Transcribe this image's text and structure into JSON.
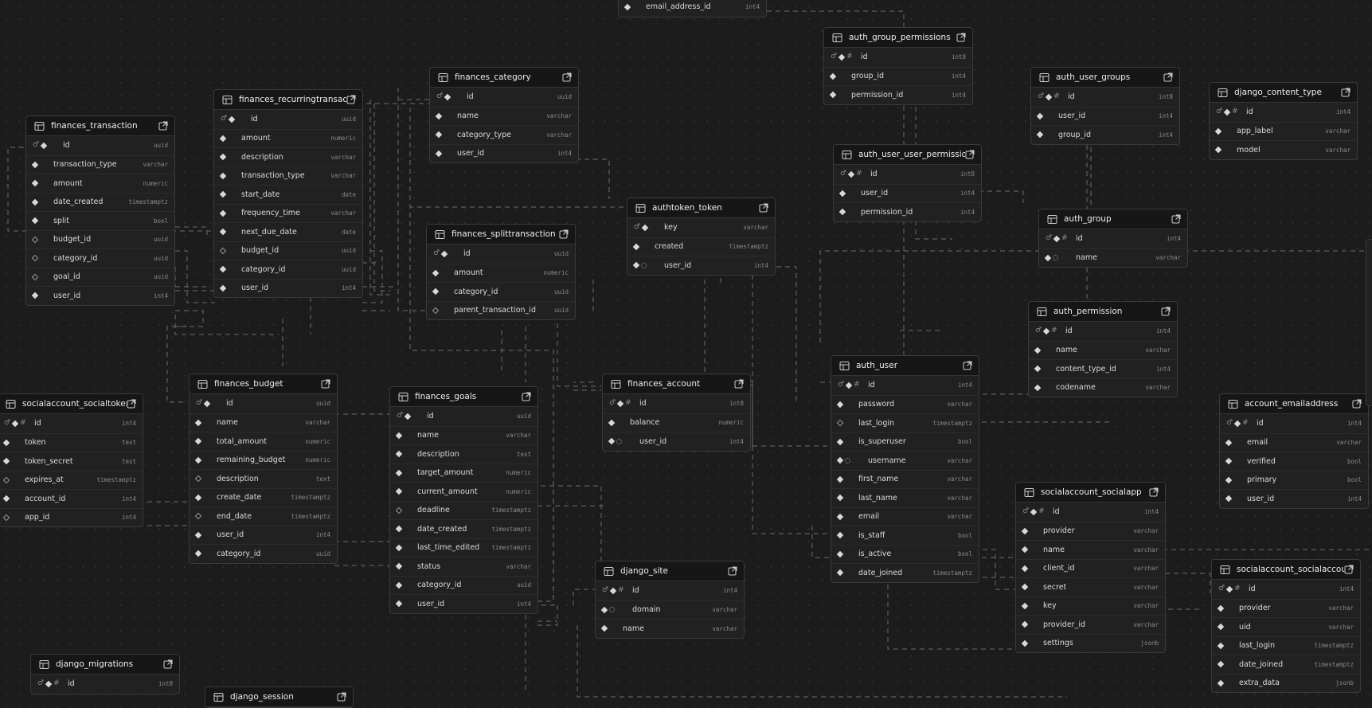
{
  "theme": {
    "background": "#1c1c1c",
    "table_bg": "#212121",
    "header_bg": "#161616",
    "edge": "#5e5e5e"
  },
  "tables": {
    "partial_top": {
      "columns": [
        {
          "name": "email_address_id",
          "type": "int4"
        }
      ]
    },
    "finances_transaction": {
      "name": "finances_transaction",
      "columns": [
        {
          "name": "id",
          "type": "uuid"
        },
        {
          "name": "transaction_type",
          "type": "varchar"
        },
        {
          "name": "amount",
          "type": "numeric"
        },
        {
          "name": "date_created",
          "type": "timestamptz"
        },
        {
          "name": "split",
          "type": "bool"
        },
        {
          "name": "budget_id",
          "type": "uuid"
        },
        {
          "name": "category_id",
          "type": "uuid"
        },
        {
          "name": "goal_id",
          "type": "uuid"
        },
        {
          "name": "user_id",
          "type": "int4"
        }
      ]
    },
    "finances_recurringtransaction": {
      "name": "finances_recurringtransaction",
      "columns": [
        {
          "name": "id",
          "type": "uuid"
        },
        {
          "name": "amount",
          "type": "numeric"
        },
        {
          "name": "description",
          "type": "varchar"
        },
        {
          "name": "transaction_type",
          "type": "varchar"
        },
        {
          "name": "start_date",
          "type": "date"
        },
        {
          "name": "frequency_time",
          "type": "varchar"
        },
        {
          "name": "next_due_date",
          "type": "date"
        },
        {
          "name": "budget_id",
          "type": "uuid"
        },
        {
          "name": "category_id",
          "type": "uuid"
        },
        {
          "name": "user_id",
          "type": "int4"
        }
      ]
    },
    "finances_category": {
      "name": "finances_category",
      "columns": [
        {
          "name": "id",
          "type": "uuid"
        },
        {
          "name": "name",
          "type": "varchar"
        },
        {
          "name": "category_type",
          "type": "varchar"
        },
        {
          "name": "user_id",
          "type": "int4"
        }
      ]
    },
    "finances_splittransaction": {
      "name": "finances_splittransaction",
      "columns": [
        {
          "name": "id",
          "type": "uuid"
        },
        {
          "name": "amount",
          "type": "numeric"
        },
        {
          "name": "category_id",
          "type": "uuid"
        },
        {
          "name": "parent_transaction_id",
          "type": "uuid"
        }
      ]
    },
    "authtoken_token": {
      "name": "authtoken_token",
      "columns": [
        {
          "name": "key",
          "type": "varchar"
        },
        {
          "name": "created",
          "type": "timestamptz"
        },
        {
          "name": "user_id",
          "type": "int4"
        }
      ]
    },
    "auth_group_permissions": {
      "name": "auth_group_permissions",
      "columns": [
        {
          "name": "id",
          "type": "int8"
        },
        {
          "name": "group_id",
          "type": "int4"
        },
        {
          "name": "permission_id",
          "type": "int4"
        }
      ]
    },
    "auth_user_user_permissions": {
      "name": "auth_user_user_permissions",
      "columns": [
        {
          "name": "id",
          "type": "int8"
        },
        {
          "name": "user_id",
          "type": "int4"
        },
        {
          "name": "permission_id",
          "type": "int4"
        }
      ]
    },
    "auth_user_groups": {
      "name": "auth_user_groups",
      "columns": [
        {
          "name": "id",
          "type": "int8"
        },
        {
          "name": "user_id",
          "type": "int4"
        },
        {
          "name": "group_id",
          "type": "int4"
        }
      ]
    },
    "django_content_type": {
      "name": "django_content_type",
      "columns": [
        {
          "name": "id",
          "type": "int4"
        },
        {
          "name": "app_label",
          "type": "varchar"
        },
        {
          "name": "model",
          "type": "varchar"
        }
      ]
    },
    "auth_group": {
      "name": "auth_group",
      "columns": [
        {
          "name": "id",
          "type": "int4"
        },
        {
          "name": "name",
          "type": "varchar"
        }
      ]
    },
    "auth_permission": {
      "name": "auth_permission",
      "columns": [
        {
          "name": "id",
          "type": "int4"
        },
        {
          "name": "name",
          "type": "varchar"
        },
        {
          "name": "content_type_id",
          "type": "int4"
        },
        {
          "name": "codename",
          "type": "varchar"
        }
      ]
    },
    "auth_user": {
      "name": "auth_user",
      "columns": [
        {
          "name": "id",
          "type": "int4"
        },
        {
          "name": "password",
          "type": "varchar"
        },
        {
          "name": "last_login",
          "type": "timestamptz"
        },
        {
          "name": "is_superuser",
          "type": "bool"
        },
        {
          "name": "username",
          "type": "varchar"
        },
        {
          "name": "first_name",
          "type": "varchar"
        },
        {
          "name": "last_name",
          "type": "varchar"
        },
        {
          "name": "email",
          "type": "varchar"
        },
        {
          "name": "is_staff",
          "type": "bool"
        },
        {
          "name": "is_active",
          "type": "bool"
        },
        {
          "name": "date_joined",
          "type": "timestamptz"
        }
      ]
    },
    "account_emailaddress": {
      "name": "account_emailaddress",
      "columns": [
        {
          "name": "id",
          "type": "int4"
        },
        {
          "name": "email",
          "type": "varchar"
        },
        {
          "name": "verified",
          "type": "bool"
        },
        {
          "name": "primary",
          "type": "bool"
        },
        {
          "name": "user_id",
          "type": "int4"
        }
      ]
    },
    "socialaccount_socialtoken": {
      "name": "socialaccount_socialtoken",
      "columns": [
        {
          "name": "id",
          "type": "int4"
        },
        {
          "name": "token",
          "type": "text"
        },
        {
          "name": "token_secret",
          "type": "text"
        },
        {
          "name": "expires_at",
          "type": "timestamptz"
        },
        {
          "name": "account_id",
          "type": "int4"
        },
        {
          "name": "app_id",
          "type": "int4"
        }
      ]
    },
    "finances_budget": {
      "name": "finances_budget",
      "columns": [
        {
          "name": "id",
          "type": "uuid"
        },
        {
          "name": "name",
          "type": "varchar"
        },
        {
          "name": "total_amount",
          "type": "numeric"
        },
        {
          "name": "remaining_budget",
          "type": "numeric"
        },
        {
          "name": "description",
          "type": "text"
        },
        {
          "name": "create_date",
          "type": "timestamptz"
        },
        {
          "name": "end_date",
          "type": "timestamptz"
        },
        {
          "name": "user_id",
          "type": "int4"
        },
        {
          "name": "category_id",
          "type": "uuid"
        }
      ]
    },
    "finances_goals": {
      "name": "finances_goals",
      "columns": [
        {
          "name": "id",
          "type": "uuid"
        },
        {
          "name": "name",
          "type": "varchar"
        },
        {
          "name": "description",
          "type": "text"
        },
        {
          "name": "target_amount",
          "type": "numeric"
        },
        {
          "name": "current_amount",
          "type": "numeric"
        },
        {
          "name": "deadline",
          "type": "timestamptz"
        },
        {
          "name": "date_created",
          "type": "timestamptz"
        },
        {
          "name": "last_time_edited",
          "type": "timestamptz"
        },
        {
          "name": "status",
          "type": "varchar"
        },
        {
          "name": "category_id",
          "type": "uuid"
        },
        {
          "name": "user_id",
          "type": "int4"
        }
      ]
    },
    "finances_account": {
      "name": "finances_account",
      "columns": [
        {
          "name": "id",
          "type": "int8"
        },
        {
          "name": "balance",
          "type": "numeric"
        },
        {
          "name": "user_id",
          "type": "int4"
        }
      ]
    },
    "django_site": {
      "name": "django_site",
      "columns": [
        {
          "name": "id",
          "type": "int4"
        },
        {
          "name": "domain",
          "type": "varchar"
        },
        {
          "name": "name",
          "type": "varchar"
        }
      ]
    },
    "socialaccount_socialapp": {
      "name": "socialaccount_socialapp",
      "columns": [
        {
          "name": "id",
          "type": "int4"
        },
        {
          "name": "provider",
          "type": "varchar"
        },
        {
          "name": "name",
          "type": "varchar"
        },
        {
          "name": "client_id",
          "type": "varchar"
        },
        {
          "name": "secret",
          "type": "varchar"
        },
        {
          "name": "key",
          "type": "varchar"
        },
        {
          "name": "provider_id",
          "type": "varchar"
        },
        {
          "name": "settings",
          "type": "jsonb"
        }
      ]
    },
    "socialaccount_socialaccount": {
      "name": "socialaccount_socialaccount",
      "columns": [
        {
          "name": "id",
          "type": "int4"
        },
        {
          "name": "provider",
          "type": "varchar"
        },
        {
          "name": "uid",
          "type": "varchar"
        },
        {
          "name": "last_login",
          "type": "timestamptz"
        },
        {
          "name": "date_joined",
          "type": "timestamptz"
        },
        {
          "name": "extra_data",
          "type": "jsonb"
        }
      ]
    },
    "django_migrations": {
      "name": "django_migrations",
      "columns": [
        {
          "name": "id",
          "type": "int8"
        }
      ]
    },
    "django_session": {
      "name": "django_session",
      "columns": []
    }
  }
}
